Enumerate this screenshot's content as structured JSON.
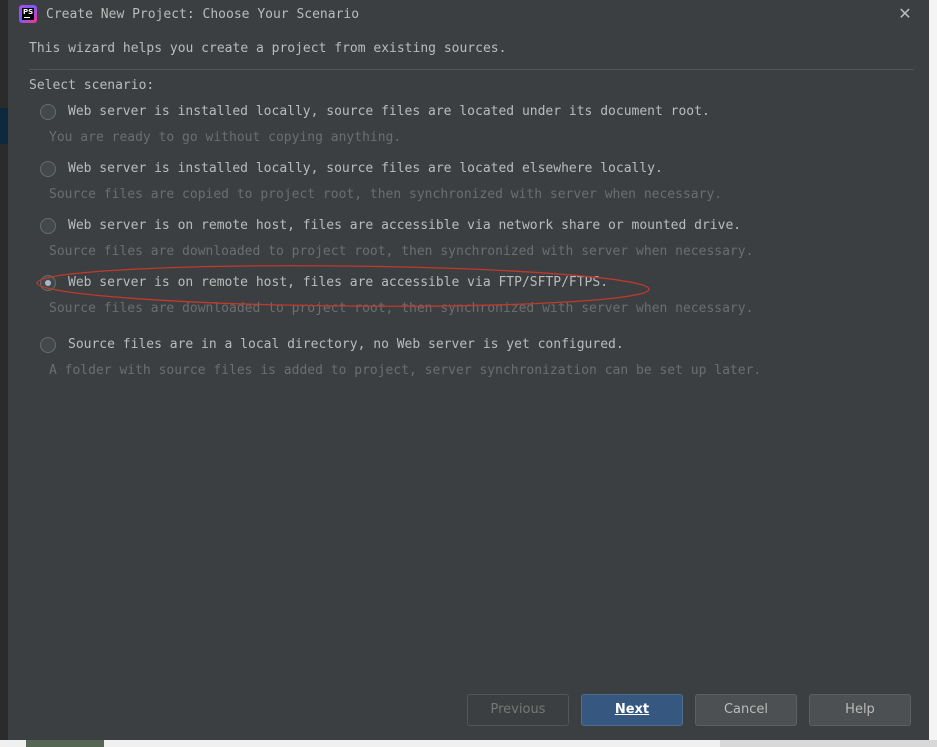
{
  "dialog": {
    "title": "Create New Project: Choose Your Scenario",
    "app_icon_text": "PS",
    "close_symbol": "✕",
    "intro": "This wizard helps you create a project from existing sources.",
    "select_label": "Select scenario:"
  },
  "options": [
    {
      "label": "Web server is installed locally, source files are located under its document root.",
      "description": "You are ready to go without copying anything.",
      "selected": false
    },
    {
      "label": "Web server is installed locally, source files are located elsewhere locally.",
      "description": "Source files are copied to project root, then synchronized with server when necessary.",
      "selected": false
    },
    {
      "label": "Web server is on remote host, files are accessible via network share or mounted drive.",
      "description": "Source files are downloaded to project root, then synchronized with server when necessary.",
      "selected": false
    },
    {
      "label": "Web server is on remote host, files are accessible via FTP/SFTP/FTPS.",
      "description": "Source files are downloaded to project root, then synchronized with server when necessary.",
      "selected": true
    },
    {
      "label": "Source files are in a local directory, no Web server is yet configured.",
      "description": "A folder with source files is added to project, server synchronization can be set up later.",
      "selected": false
    }
  ],
  "buttons": {
    "previous": "Previous",
    "next": "Next",
    "cancel": "Cancel",
    "help": "Help"
  },
  "annotation": {
    "color": "#c0392b"
  },
  "colors": {
    "dialog_bg": "#3c3f41",
    "primary_button": "#365880",
    "text": "#bbbbbb",
    "muted_text": "#6b6e70"
  }
}
